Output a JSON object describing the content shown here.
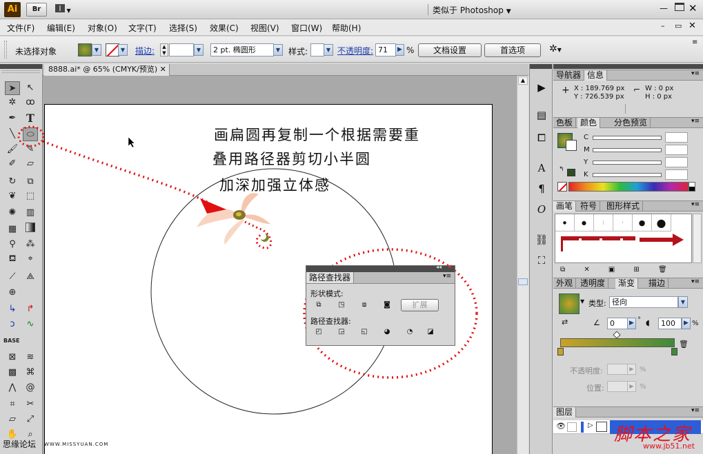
{
  "app": {
    "logo": "Ai",
    "bridge": "Br",
    "workspace": "类似于 Photoshop"
  },
  "menus": [
    "文件(F)",
    "编辑(E)",
    "对象(O)",
    "文字(T)",
    "选择(S)",
    "效果(C)",
    "视图(V)",
    "窗口(W)",
    "帮助(H)"
  ],
  "control_bar": {
    "selection": "未选择对象",
    "stroke_label": "描边:",
    "stroke_weight": "2 pt. 椭圆形",
    "style_label": "样式:",
    "opacity_label": "不透明度:",
    "opacity_value": "71",
    "percent": "%",
    "doc_setup": "文档设置",
    "preferences": "首选项"
  },
  "document": {
    "tab": "8888.ai* @ 65% (CMYK/预览)"
  },
  "canvas_notes": [
    "画扁圆再复制一个根据需要重",
    "叠用路径器剪切小半圆",
    "加深加强立体感"
  ],
  "pathfinder": {
    "title": "路径查找器",
    "shape_modes": "形状模式:",
    "expand": "扩展",
    "pathfinders": "路径查找器:"
  },
  "info_panel": {
    "tabs": [
      "导航器",
      "信息"
    ],
    "x": "X : 189.769 px",
    "y": "Y : 726.539 px",
    "w": "W : 0 px",
    "h": "H : 0 px"
  },
  "color_panel": {
    "tabs": [
      "色板",
      "颜色",
      "分色预览"
    ],
    "channels": [
      "C",
      "M",
      "Y",
      "K"
    ]
  },
  "brush_panel": {
    "tabs": [
      "画笔",
      "符号",
      "图形样式"
    ]
  },
  "gradient_panel": {
    "tabs": [
      "外观",
      "透明度",
      "渐变",
      "描边"
    ],
    "type_label": "类型:",
    "type_value": "径向",
    "angle": "0",
    "aspect": "100",
    "aspect_unit": "%",
    "opacity_label": "不透明度:",
    "location_label": "位置:",
    "pct": "%"
  },
  "layers_panel": {
    "tabs": [
      "图层"
    ]
  },
  "watermarks": {
    "left": "思缘论坛",
    "left_url": "WWW.MISSYUAN.COM",
    "right": "脚本之家",
    "right_url": "www.jb51.net"
  },
  "colors": {
    "accent_red": "#e01010",
    "grad_start": "#caa226",
    "grad_end": "#3f8a3a"
  }
}
